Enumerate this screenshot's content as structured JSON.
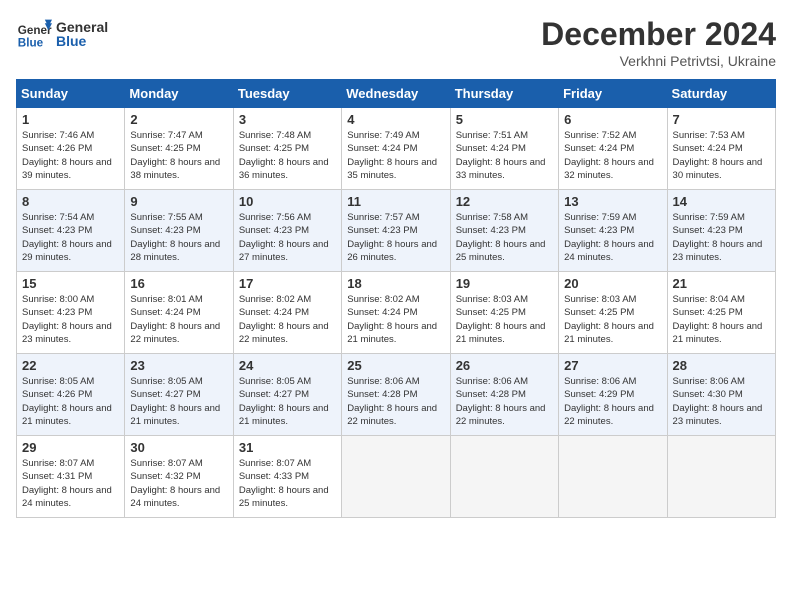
{
  "header": {
    "logo_general": "General",
    "logo_blue": "Blue",
    "month_title": "December 2024",
    "location": "Verkhni Petrivtsi, Ukraine"
  },
  "days_of_week": [
    "Sunday",
    "Monday",
    "Tuesday",
    "Wednesday",
    "Thursday",
    "Friday",
    "Saturday"
  ],
  "weeks": [
    [
      {
        "day": "1",
        "sunrise": "7:46 AM",
        "sunset": "4:26 PM",
        "daylight": "8 hours and 39 minutes."
      },
      {
        "day": "2",
        "sunrise": "7:47 AM",
        "sunset": "4:25 PM",
        "daylight": "8 hours and 38 minutes."
      },
      {
        "day": "3",
        "sunrise": "7:48 AM",
        "sunset": "4:25 PM",
        "daylight": "8 hours and 36 minutes."
      },
      {
        "day": "4",
        "sunrise": "7:49 AM",
        "sunset": "4:24 PM",
        "daylight": "8 hours and 35 minutes."
      },
      {
        "day": "5",
        "sunrise": "7:51 AM",
        "sunset": "4:24 PM",
        "daylight": "8 hours and 33 minutes."
      },
      {
        "day": "6",
        "sunrise": "7:52 AM",
        "sunset": "4:24 PM",
        "daylight": "8 hours and 32 minutes."
      },
      {
        "day": "7",
        "sunrise": "7:53 AM",
        "sunset": "4:24 PM",
        "daylight": "8 hours and 30 minutes."
      }
    ],
    [
      {
        "day": "8",
        "sunrise": "7:54 AM",
        "sunset": "4:23 PM",
        "daylight": "8 hours and 29 minutes."
      },
      {
        "day": "9",
        "sunrise": "7:55 AM",
        "sunset": "4:23 PM",
        "daylight": "8 hours and 28 minutes."
      },
      {
        "day": "10",
        "sunrise": "7:56 AM",
        "sunset": "4:23 PM",
        "daylight": "8 hours and 27 minutes."
      },
      {
        "day": "11",
        "sunrise": "7:57 AM",
        "sunset": "4:23 PM",
        "daylight": "8 hours and 26 minutes."
      },
      {
        "day": "12",
        "sunrise": "7:58 AM",
        "sunset": "4:23 PM",
        "daylight": "8 hours and 25 minutes."
      },
      {
        "day": "13",
        "sunrise": "7:59 AM",
        "sunset": "4:23 PM",
        "daylight": "8 hours and 24 minutes."
      },
      {
        "day": "14",
        "sunrise": "7:59 AM",
        "sunset": "4:23 PM",
        "daylight": "8 hours and 23 minutes."
      }
    ],
    [
      {
        "day": "15",
        "sunrise": "8:00 AM",
        "sunset": "4:23 PM",
        "daylight": "8 hours and 23 minutes."
      },
      {
        "day": "16",
        "sunrise": "8:01 AM",
        "sunset": "4:24 PM",
        "daylight": "8 hours and 22 minutes."
      },
      {
        "day": "17",
        "sunrise": "8:02 AM",
        "sunset": "4:24 PM",
        "daylight": "8 hours and 22 minutes."
      },
      {
        "day": "18",
        "sunrise": "8:02 AM",
        "sunset": "4:24 PM",
        "daylight": "8 hours and 21 minutes."
      },
      {
        "day": "19",
        "sunrise": "8:03 AM",
        "sunset": "4:25 PM",
        "daylight": "8 hours and 21 minutes."
      },
      {
        "day": "20",
        "sunrise": "8:03 AM",
        "sunset": "4:25 PM",
        "daylight": "8 hours and 21 minutes."
      },
      {
        "day": "21",
        "sunrise": "8:04 AM",
        "sunset": "4:25 PM",
        "daylight": "8 hours and 21 minutes."
      }
    ],
    [
      {
        "day": "22",
        "sunrise": "8:05 AM",
        "sunset": "4:26 PM",
        "daylight": "8 hours and 21 minutes."
      },
      {
        "day": "23",
        "sunrise": "8:05 AM",
        "sunset": "4:27 PM",
        "daylight": "8 hours and 21 minutes."
      },
      {
        "day": "24",
        "sunrise": "8:05 AM",
        "sunset": "4:27 PM",
        "daylight": "8 hours and 21 minutes."
      },
      {
        "day": "25",
        "sunrise": "8:06 AM",
        "sunset": "4:28 PM",
        "daylight": "8 hours and 22 minutes."
      },
      {
        "day": "26",
        "sunrise": "8:06 AM",
        "sunset": "4:28 PM",
        "daylight": "8 hours and 22 minutes."
      },
      {
        "day": "27",
        "sunrise": "8:06 AM",
        "sunset": "4:29 PM",
        "daylight": "8 hours and 22 minutes."
      },
      {
        "day": "28",
        "sunrise": "8:06 AM",
        "sunset": "4:30 PM",
        "daylight": "8 hours and 23 minutes."
      }
    ],
    [
      {
        "day": "29",
        "sunrise": "8:07 AM",
        "sunset": "4:31 PM",
        "daylight": "8 hours and 24 minutes."
      },
      {
        "day": "30",
        "sunrise": "8:07 AM",
        "sunset": "4:32 PM",
        "daylight": "8 hours and 24 minutes."
      },
      {
        "day": "31",
        "sunrise": "8:07 AM",
        "sunset": "4:33 PM",
        "daylight": "8 hours and 25 minutes."
      },
      null,
      null,
      null,
      null
    ]
  ],
  "labels": {
    "sunrise": "Sunrise:",
    "sunset": "Sunset:",
    "daylight": "Daylight:"
  }
}
